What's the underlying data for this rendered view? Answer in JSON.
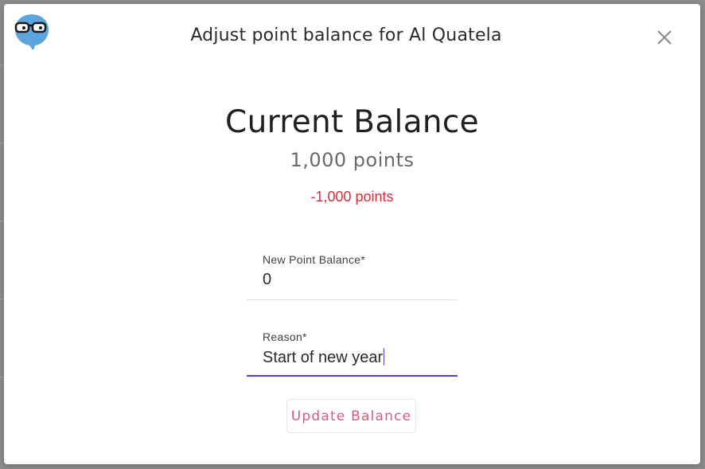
{
  "modal": {
    "title": "Adjust point balance for Al Quatela",
    "logo_icon": "glasses-speech-bubble-icon",
    "close_icon": "close-icon"
  },
  "balance": {
    "heading": "Current Balance",
    "current": "1,000 points",
    "delta": "-1,000 points",
    "delta_color": "#d32f3a"
  },
  "form": {
    "new_balance": {
      "label": "New Point Balance*",
      "value": "0"
    },
    "reason": {
      "label": "Reason*",
      "value": "Start of new year"
    },
    "submit_label": "Update Balance"
  },
  "colors": {
    "accent": "#5a3fc0",
    "button_text": "#e0567e",
    "logo_blue": "#5ba4dc"
  }
}
